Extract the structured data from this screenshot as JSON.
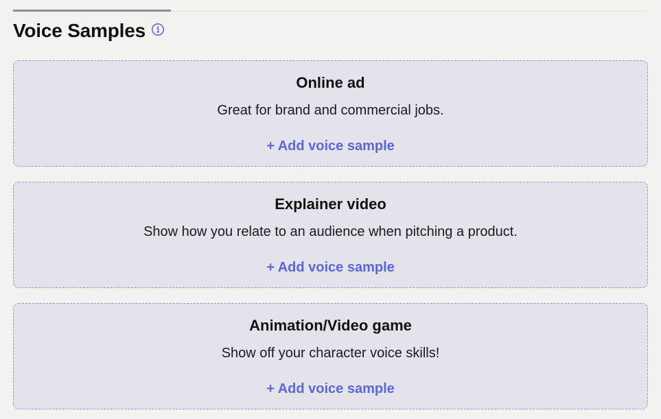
{
  "section": {
    "title": "Voice Samples",
    "info_icon": "info-circle-icon",
    "accent_color": "#5a67d8"
  },
  "cards": [
    {
      "title": "Online ad",
      "description": "Great for brand and commercial jobs.",
      "action_label": "+ Add voice sample"
    },
    {
      "title": "Explainer video",
      "description": "Show how you relate to an audience when pitching a product.",
      "action_label": "+ Add voice sample"
    },
    {
      "title": "Animation/Video game",
      "description": "Show off your character voice skills!",
      "action_label": "+ Add voice sample"
    }
  ]
}
